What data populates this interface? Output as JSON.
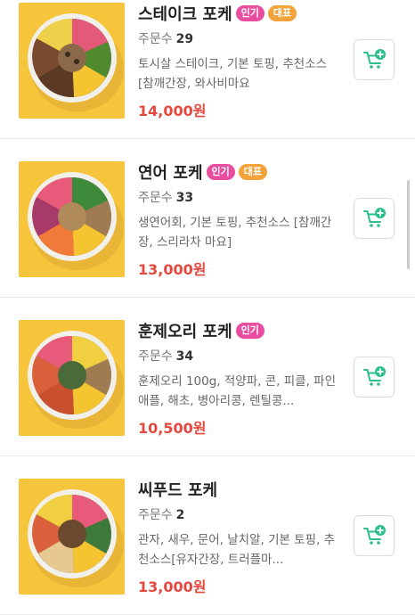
{
  "menu": {
    "orders_label": "주문수",
    "items": [
      {
        "name": "스테이크 포케",
        "badges": [
          "인기",
          "대표"
        ],
        "orders": "29",
        "description": "토시살 스테이크, 기본 토핑, 추천소스 [참깨간장, 와사비마요",
        "price": "14,000원"
      },
      {
        "name": "연어 포케",
        "badges": [
          "인기",
          "대표"
        ],
        "orders": "33",
        "description": "생연어회, 기본 토핑, 추천소스 [참깨간장, 스리라차 마요]",
        "price": "13,000원"
      },
      {
        "name": "훈제오리 포케",
        "badges": [
          "인기"
        ],
        "orders": "34",
        "description": "훈제오리 100g, 적양파, 콘, 피클, 파인애플, 해초, 병아리콩, 렌틸콩...",
        "price": "10,500원"
      },
      {
        "name": "씨푸드 포케",
        "badges": [],
        "orders": "2",
        "description": "관자, 새우, 문어, 날치알, 기본 토핑, 추천소스[유자간장, 트러플마...",
        "price": "13,000원"
      }
    ]
  },
  "icons": {
    "cart": "add-to-cart-icon"
  },
  "colors": {
    "accent_green": "#2dbf8a",
    "price_red": "#e4483e",
    "badge_hot": "#e84da0",
    "badge_rep": "#f2a33a",
    "thumb_bg": "#f6c53c"
  }
}
